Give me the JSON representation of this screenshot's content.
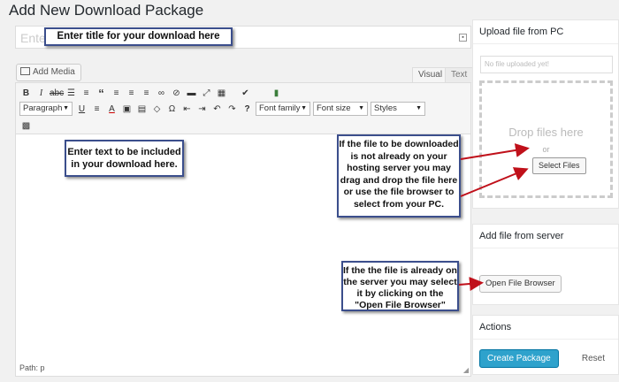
{
  "page": {
    "title": "Add New Download Package"
  },
  "title_field": {
    "placeholder": "Ente"
  },
  "editor": {
    "add_media_label": "Add Media",
    "tabs": {
      "visual": "Visual",
      "text": "Text"
    },
    "selects": {
      "format": "Paragraph",
      "font_family": "Font family",
      "font_size": "Font size",
      "styles": "Styles"
    },
    "path_label": "Path: p"
  },
  "callouts": {
    "title": "Enter title for your download here",
    "text": "Enter text to be included in your download here.",
    "file": "If the file to be downloaded is not already on your hosting server you may drag and drop the file here or use the file browser to select from your PC.",
    "server": "If the the file is already on the server you may select  it by clicking on the \"Open File Browser\""
  },
  "sidebar": {
    "upload": {
      "heading": "Upload file from PC",
      "status": "No file uploaded yet!",
      "drop_text": "Drop files here",
      "or_text": "or",
      "select_button": "Select Files"
    },
    "server": {
      "heading": "Add file from server",
      "open_button": "Open File Browser"
    },
    "actions": {
      "heading": "Actions",
      "create_button": "Create Package",
      "reset_link": "Reset"
    }
  },
  "colors": {
    "callout_border": "#3b4e8c",
    "arrow": "#c0101a",
    "primary_button": "#2ea2cc"
  }
}
